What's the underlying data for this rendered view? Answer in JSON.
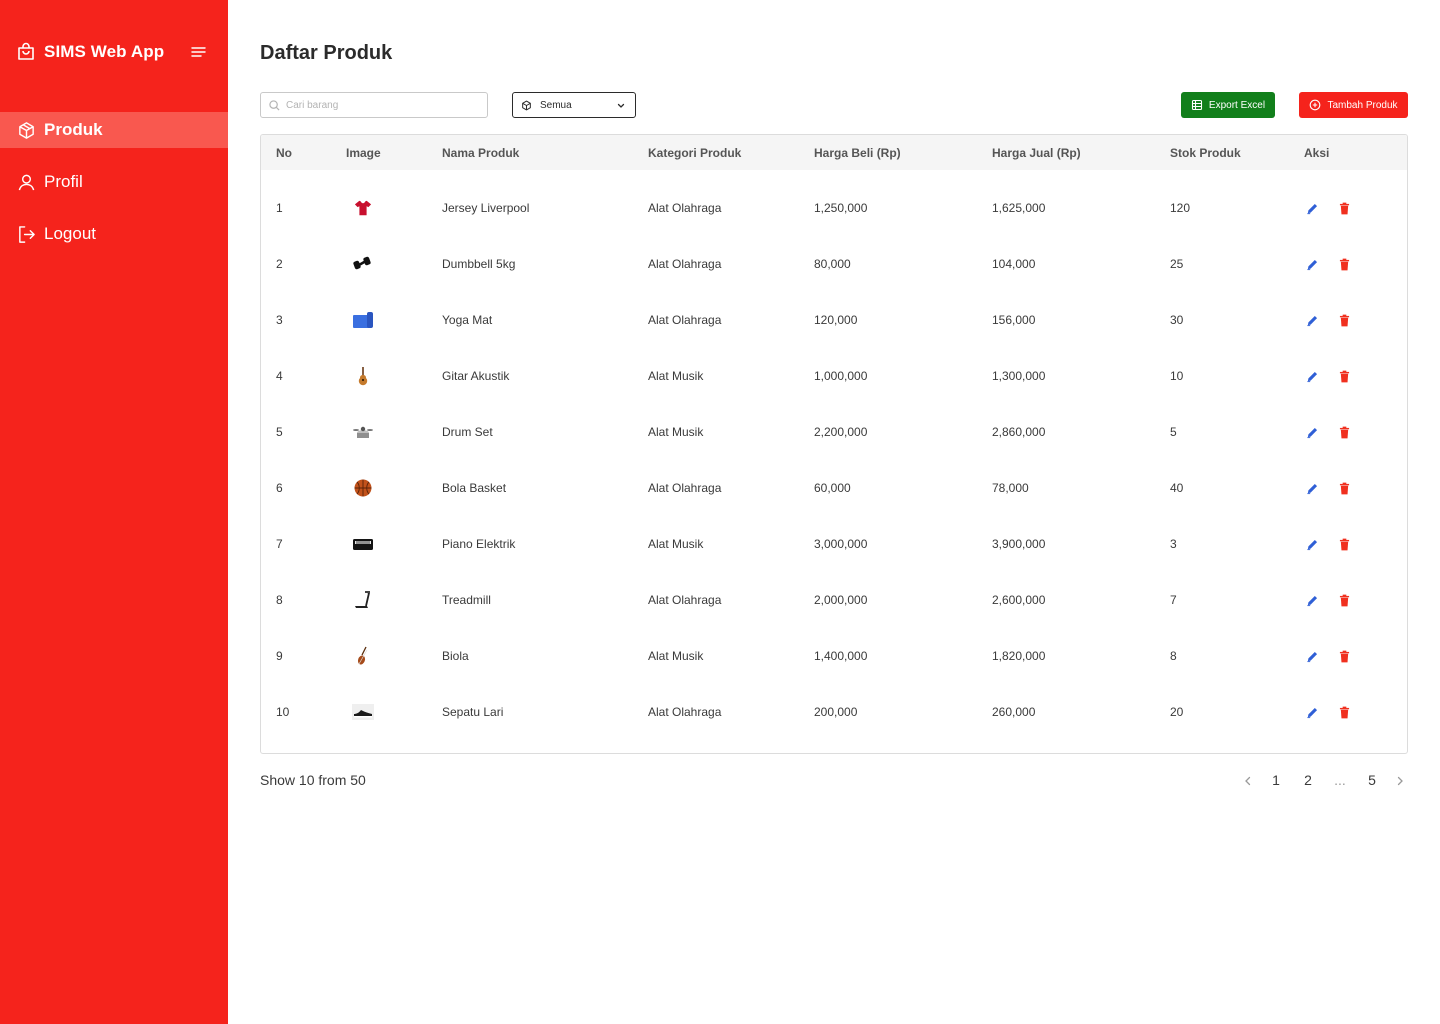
{
  "app": {
    "name": "SIMS Web App"
  },
  "sidebar": {
    "items": [
      {
        "label": "Produk",
        "icon": "box-icon",
        "active": true
      },
      {
        "label": "Profil",
        "icon": "user-icon",
        "active": false
      },
      {
        "label": "Logout",
        "icon": "logout-icon",
        "active": false
      }
    ]
  },
  "page": {
    "title": "Daftar Produk"
  },
  "toolbar": {
    "search_placeholder": "Cari barang",
    "search_value": "",
    "category_selected": "Semua",
    "export_label": "Export Excel",
    "add_label": "Tambah Produk"
  },
  "table": {
    "columns": [
      "No",
      "Image",
      "Nama Produk",
      "Kategori Produk",
      "Harga Beli (Rp)",
      "Harga Jual (Rp)",
      "Stok Produk",
      "Aksi"
    ],
    "rows": [
      {
        "no": "1",
        "image": "jersey-icon",
        "name": "Jersey Liverpool",
        "category": "Alat Olahraga",
        "buy": "1,250,000",
        "sell": "1,625,000",
        "stock": "120"
      },
      {
        "no": "2",
        "image": "dumbbell-icon",
        "name": "Dumbbell 5kg",
        "category": "Alat Olahraga",
        "buy": "80,000",
        "sell": "104,000",
        "stock": "25"
      },
      {
        "no": "3",
        "image": "yoga-mat-icon",
        "name": "Yoga Mat",
        "category": "Alat Olahraga",
        "buy": "120,000",
        "sell": "156,000",
        "stock": "30"
      },
      {
        "no": "4",
        "image": "guitar-icon",
        "name": "Gitar Akustik",
        "category": "Alat Musik",
        "buy": "1,000,000",
        "sell": "1,300,000",
        "stock": "10"
      },
      {
        "no": "5",
        "image": "drum-icon",
        "name": "Drum Set",
        "category": "Alat Musik",
        "buy": "2,200,000",
        "sell": "2,860,000",
        "stock": "5"
      },
      {
        "no": "6",
        "image": "basketball-icon",
        "name": "Bola Basket",
        "category": "Alat Olahraga",
        "buy": "60,000",
        "sell": "78,000",
        "stock": "40"
      },
      {
        "no": "7",
        "image": "keyboard-icon",
        "name": "Piano Elektrik",
        "category": "Alat Musik",
        "buy": "3,000,000",
        "sell": "3,900,000",
        "stock": "3"
      },
      {
        "no": "8",
        "image": "treadmill-icon",
        "name": "Treadmill",
        "category": "Alat Olahraga",
        "buy": "2,000,000",
        "sell": "2,600,000",
        "stock": "7"
      },
      {
        "no": "9",
        "image": "violin-icon",
        "name": "Biola",
        "category": "Alat Musik",
        "buy": "1,400,000",
        "sell": "1,820,000",
        "stock": "8"
      },
      {
        "no": "10",
        "image": "shoe-icon",
        "name": "Sepatu Lari",
        "category": "Alat Olahraga",
        "buy": "200,000",
        "sell": "260,000",
        "stock": "20"
      }
    ]
  },
  "footer": {
    "summary": "Show 10 from 50",
    "pages": [
      "1",
      "2",
      "...",
      "5"
    ]
  },
  "colors": {
    "primary": "#f5231c",
    "sidebar_active": "#f9584f",
    "export": "#127f1b",
    "edit": "#2f5fd6",
    "delete": "#f0301f"
  }
}
